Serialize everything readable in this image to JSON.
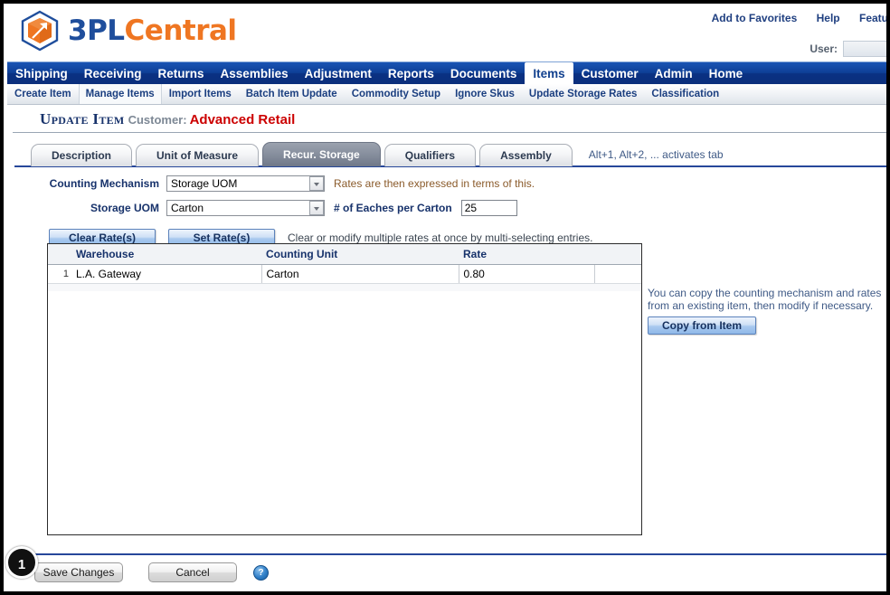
{
  "header": {
    "logo_primary": "3PL",
    "logo_secondary": "Central",
    "logo_icon": "cube-arrow-logo",
    "links": [
      {
        "label": "Add to Favorites",
        "name": "add-to-favorites-link"
      },
      {
        "label": "Help",
        "name": "help-link"
      },
      {
        "label": "Featu",
        "name": "features-link"
      }
    ],
    "user_label": "User:"
  },
  "mainnav": {
    "items": [
      {
        "label": "Shipping",
        "active": false
      },
      {
        "label": "Receiving",
        "active": false
      },
      {
        "label": "Returns",
        "active": false
      },
      {
        "label": "Assemblies",
        "active": false
      },
      {
        "label": "Adjustment",
        "active": false
      },
      {
        "label": "Reports",
        "active": false
      },
      {
        "label": "Documents",
        "active": false
      },
      {
        "label": "Items",
        "active": true
      },
      {
        "label": "Customer",
        "active": false
      },
      {
        "label": "Admin",
        "active": false
      },
      {
        "label": "Home",
        "active": false
      }
    ]
  },
  "subnav": {
    "items": [
      {
        "label": "Create Item",
        "active": false
      },
      {
        "label": "Manage Items",
        "active": true
      },
      {
        "label": "Import Items",
        "active": false
      },
      {
        "label": "Batch Item Update",
        "active": false
      },
      {
        "label": "Commodity Setup",
        "active": false
      },
      {
        "label": "Ignore Skus",
        "active": false
      },
      {
        "label": "Update Storage Rates",
        "active": false
      },
      {
        "label": "Classification",
        "active": false
      }
    ]
  },
  "page": {
    "title": "Update Item",
    "customer_label": "Customer:",
    "customer_name": "Advanced Retail"
  },
  "tabs": {
    "items": [
      {
        "label": "Description",
        "active": false
      },
      {
        "label": "Unit of Measure",
        "active": false
      },
      {
        "label": "Recur. Storage",
        "active": true
      },
      {
        "label": "Qualifiers",
        "active": false
      },
      {
        "label": "Assembly",
        "active": false
      }
    ],
    "hint": "Alt+1, Alt+2, ... activates tab"
  },
  "form": {
    "counting_mechanism_label": "Counting Mechanism",
    "counting_mechanism_value": "Storage UOM",
    "counting_mechanism_hint": "Rates are then expressed in terms of this.",
    "storage_uom_label": "Storage UOM",
    "storage_uom_value": "Carton",
    "eaches_label": "# of Eaches per Carton",
    "eaches_value": "25"
  },
  "rate_actions": {
    "clear_label": "Clear Rate(s)",
    "set_label": "Set Rate(s)",
    "note": "Clear or modify multiple rates at once by multi-selecting entries."
  },
  "grid": {
    "columns": [
      "Warehouse",
      "Counting Unit",
      "Rate"
    ],
    "rows": [
      {
        "num": "1",
        "warehouse": "L.A. Gateway",
        "counting_unit": "Carton",
        "rate": "0.80"
      }
    ]
  },
  "copy_panel": {
    "text": "You can copy the counting mechanism and rates from an existing item, then modify if necessary.",
    "button_label": "Copy from Item"
  },
  "footer": {
    "save_label": "Save Changes",
    "cancel_label": "Cancel",
    "help_glyph": "?"
  },
  "callout": {
    "number": "1"
  },
  "colors": {
    "nav_blue": "#0e3f96",
    "accent_orange": "#ef7622",
    "logo_blue": "#1f4e9c",
    "customer_red": "#cc0000",
    "panel_rule": "#26479a"
  }
}
